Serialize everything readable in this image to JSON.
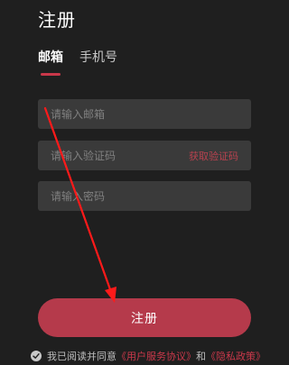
{
  "page": {
    "title": "注册"
  },
  "tabs": [
    {
      "label": "邮箱",
      "active": true
    },
    {
      "label": "手机号",
      "active": false
    }
  ],
  "form": {
    "email_placeholder": "请输入邮箱",
    "code_placeholder": "请输入验证码",
    "get_code_label": "获取验证码",
    "password_placeholder": "请输入密码",
    "submit_label": "注册"
  },
  "agreement": {
    "prefix": "我已阅读并同意",
    "user_agreement": "《用户服务协议》",
    "conjunction": "和",
    "privacy_policy": "《隐私政策》",
    "checked": true
  },
  "annotation": {
    "arrow_icon": "red-arrow-icon"
  },
  "colors": {
    "background": "#1f1f1f",
    "field": "#3a3a3a",
    "accent": "#c9384a",
    "button": "#b53a4b"
  }
}
